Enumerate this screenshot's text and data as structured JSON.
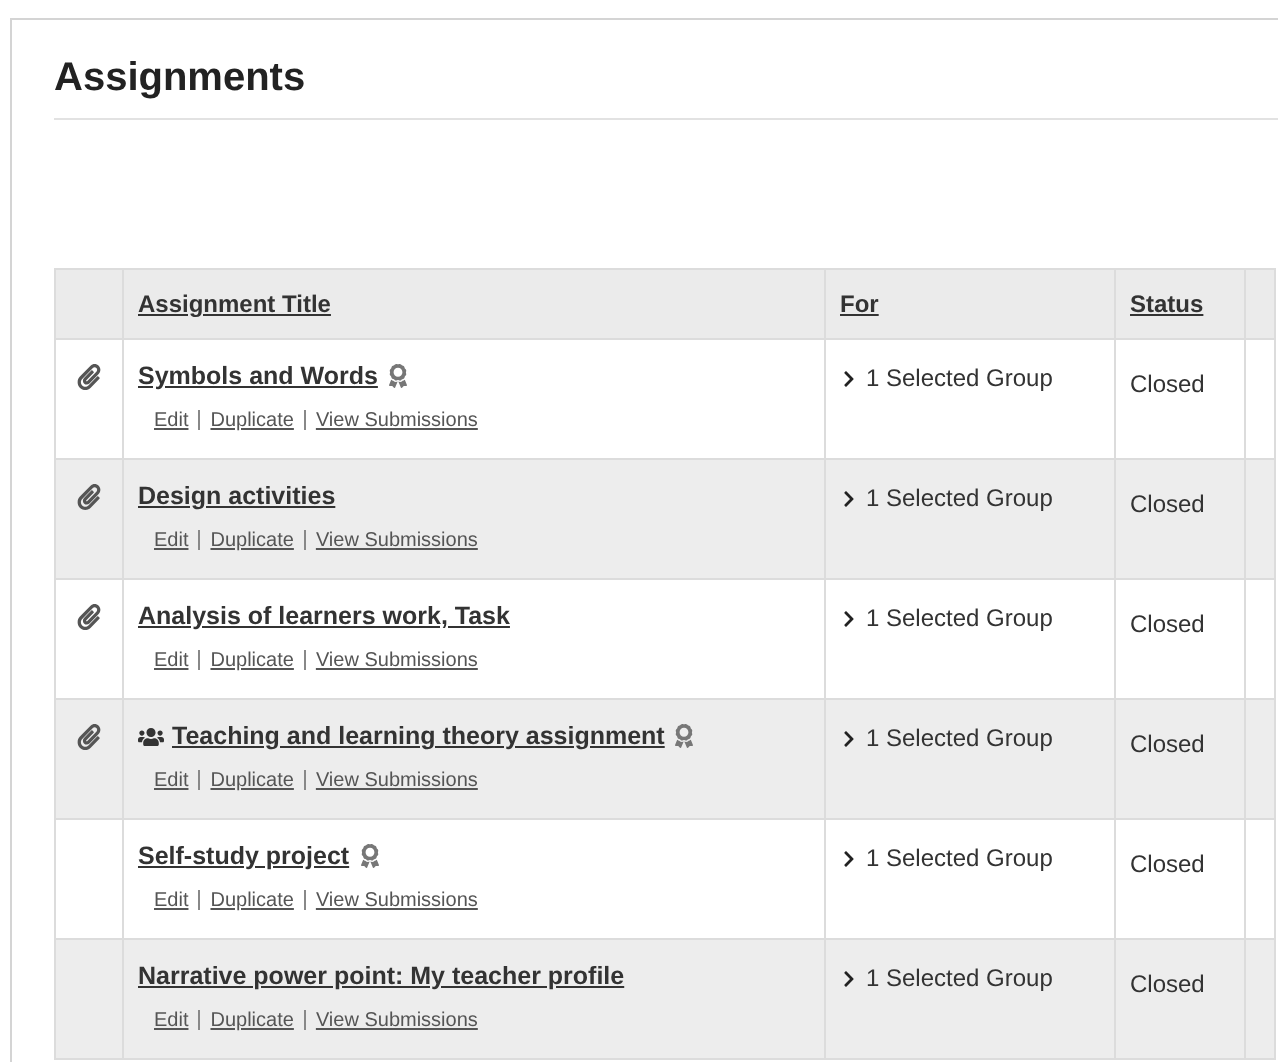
{
  "page": {
    "title": "Assignments"
  },
  "table": {
    "columns": [
      "Assignment Title",
      "For",
      "Status"
    ],
    "rows": [
      {
        "title": "Symbols and Words",
        "attachment": true,
        "group": false,
        "badge": true,
        "actions": [
          "Edit",
          "Duplicate",
          "View Submissions"
        ],
        "for": "1 Selected Group",
        "status": "Closed"
      },
      {
        "title": "Design activities",
        "attachment": true,
        "group": false,
        "badge": false,
        "actions": [
          "Edit",
          "Duplicate",
          "View Submissions"
        ],
        "for": "1 Selected Group",
        "status": "Closed"
      },
      {
        "title": "Analysis of learners work, Task",
        "attachment": true,
        "group": false,
        "badge": false,
        "actions": [
          "Edit",
          "Duplicate",
          "View Submissions"
        ],
        "for": "1 Selected Group",
        "status": "Closed"
      },
      {
        "title": "Teaching and learning theory assignment",
        "attachment": true,
        "group": true,
        "badge": true,
        "actions": [
          "Edit",
          "Duplicate",
          "View Submissions"
        ],
        "for": "1 Selected Group",
        "status": "Closed"
      },
      {
        "title": "Self-study project",
        "attachment": false,
        "group": false,
        "badge": true,
        "actions": [
          "Edit",
          "Duplicate",
          "View Submissions"
        ],
        "for": "1 Selected Group",
        "status": "Closed"
      },
      {
        "title": "Narrative power point: My teacher profile",
        "attachment": false,
        "group": false,
        "badge": false,
        "actions": [
          "Edit",
          "Duplicate",
          "View Submissions"
        ],
        "for": "1 Selected Group",
        "status": "Closed"
      }
    ]
  }
}
